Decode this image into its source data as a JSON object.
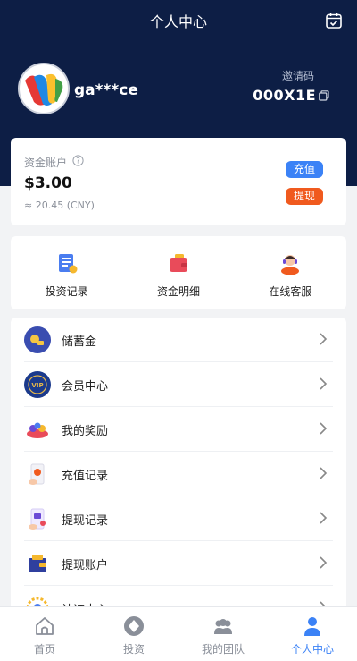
{
  "header": {
    "title": "个人中心",
    "username": "ga***ce",
    "invite_label": "邀请码",
    "invite_code": "000X1E"
  },
  "account": {
    "label": "资金账户",
    "amount": "$3.00",
    "sub_amount": "≈ 20.45 (CNY)",
    "recharge_label": "充值",
    "withdraw_label": "提现"
  },
  "quick_actions": [
    {
      "label": "投资记录",
      "icon": "scroll-icon"
    },
    {
      "label": "资金明细",
      "icon": "wallet-icon"
    },
    {
      "label": "在线客服",
      "icon": "support-agent-icon"
    }
  ],
  "menu": [
    {
      "label": "储蓄金",
      "icon": "savings-icon"
    },
    {
      "label": "会员中心",
      "icon": "vip-icon"
    },
    {
      "label": "我的奖励",
      "icon": "reward-icon"
    },
    {
      "label": "充值记录",
      "icon": "recharge-record-icon"
    },
    {
      "label": "提现记录",
      "icon": "withdraw-record-icon"
    },
    {
      "label": "提现账户",
      "icon": "withdraw-account-icon"
    },
    {
      "label": "认证中心",
      "icon": "verify-icon"
    }
  ],
  "tabs": [
    {
      "label": "首页",
      "icon": "home-icon"
    },
    {
      "label": "投资",
      "icon": "invest-icon"
    },
    {
      "label": "我的团队",
      "icon": "team-icon"
    },
    {
      "label": "个人中心",
      "icon": "profile-icon"
    }
  ],
  "colors": {
    "header_bg": "#0d1e45",
    "accent": "#3b82f6",
    "withdraw": "#f05a1e"
  }
}
